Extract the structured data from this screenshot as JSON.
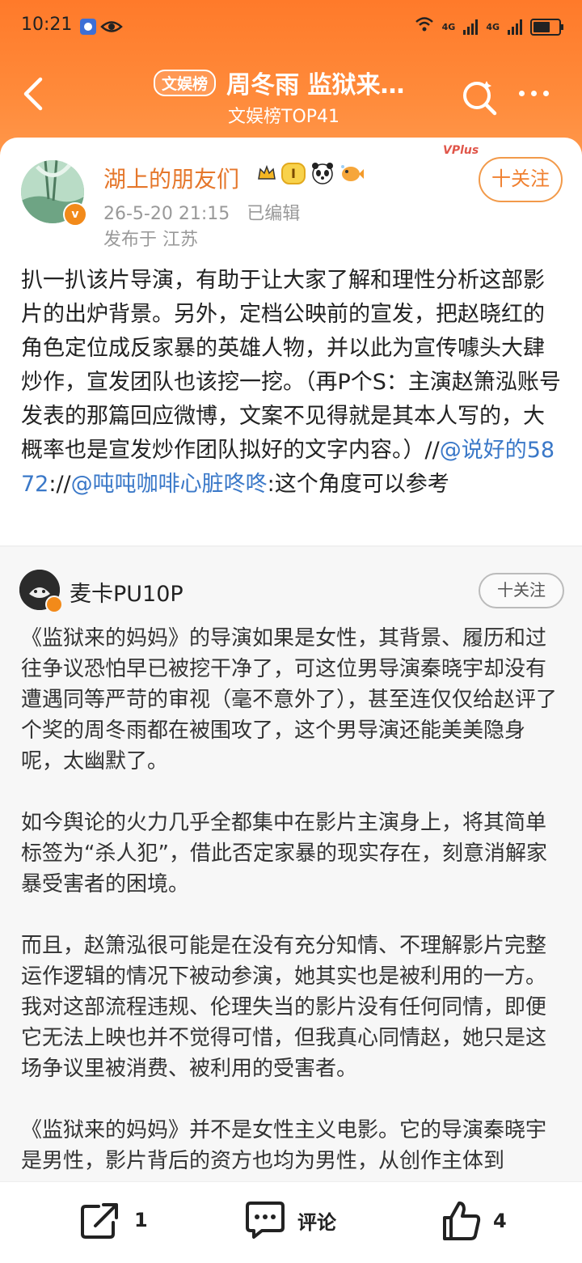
{
  "status_bar": {
    "time": "10:21",
    "net1": "4G",
    "net2": "4G"
  },
  "nav": {
    "tag": "文娱榜",
    "title": "周冬雨 监狱来…",
    "subtitle": "文娱榜TOP41"
  },
  "post": {
    "author": "湖上的朋友们",
    "level_badge": "I",
    "timestamp": "26-5-20 21:15",
    "edited": "已编辑",
    "location": "发布于 江苏",
    "vplus": "VPlus",
    "follow_label": "十关注",
    "text_main": "扒一扒该片导演，有助于让大家了解和理性分析这部影片的出炉背景。另外，定档公映前的宣发，把赵晓红的角色定位成反家暴的英雄人物，并以此为宣传噱头大肆炒作，宣发团队也该挖一挖。（再P个S：主演赵箫泓账号发表的那篇回应微博，文案不见得就是其本人写的，大概率也是宣发炒作团队拟好的文字内容。）",
    "sep1": "//",
    "mention1": "@说好的5872",
    "sep2": "://",
    "mention2": "@吨吨咖啡心脏咚咚",
    "text_tail": ":这个角度可以参考"
  },
  "repost": {
    "author": "麦卡PU10P",
    "follow_label": "十关注",
    "paragraphs": [
      "《监狱来的妈妈》的导演如果是女性，其背景、履历和过往争议恐怕早已被挖干净了，可这位男导演秦晓宇却没有遭遇同等严苛的审视（毫不意外了），甚至连仅仅给赵评了个奖的周冬雨都在被围攻了，这个男导演还能美美隐身呢，太幽默了。",
      "如今舆论的火力几乎全都集中在影片主演身上，将其简单标签为“杀人犯”，借此否定家暴的现实存在，刻意消解家暴受害者的困境。",
      "而且，赵箫泓很可能是在没有充分知情、不理解影片完整运作逻辑的情况下被动参演，她其实也是被利用的一方。我对这部流程违规、伦理失当的影片没有任何同情，即便它无法上映也并不觉得可惜，但我真心同情赵，她只是这场争议里被消费、被利用的受害者。",
      "《监狱来的妈妈》并不是女性主义电影。它的导演秦晓宇是男性，影片背后的资方也均为男性，从创作主体到"
    ]
  },
  "actions": {
    "repost_count": "1",
    "comment_label": "评论",
    "like_count": "4"
  },
  "icons": [
    "back-icon",
    "search-icon",
    "more-icon",
    "share-icon",
    "comment-icon",
    "like-icon",
    "crown-icon",
    "panda-icon",
    "fish-icon"
  ],
  "colors": {
    "header": "#ff7a2a",
    "username": "#e5772b",
    "link": "#3a78c8",
    "follow": "#f08030"
  }
}
